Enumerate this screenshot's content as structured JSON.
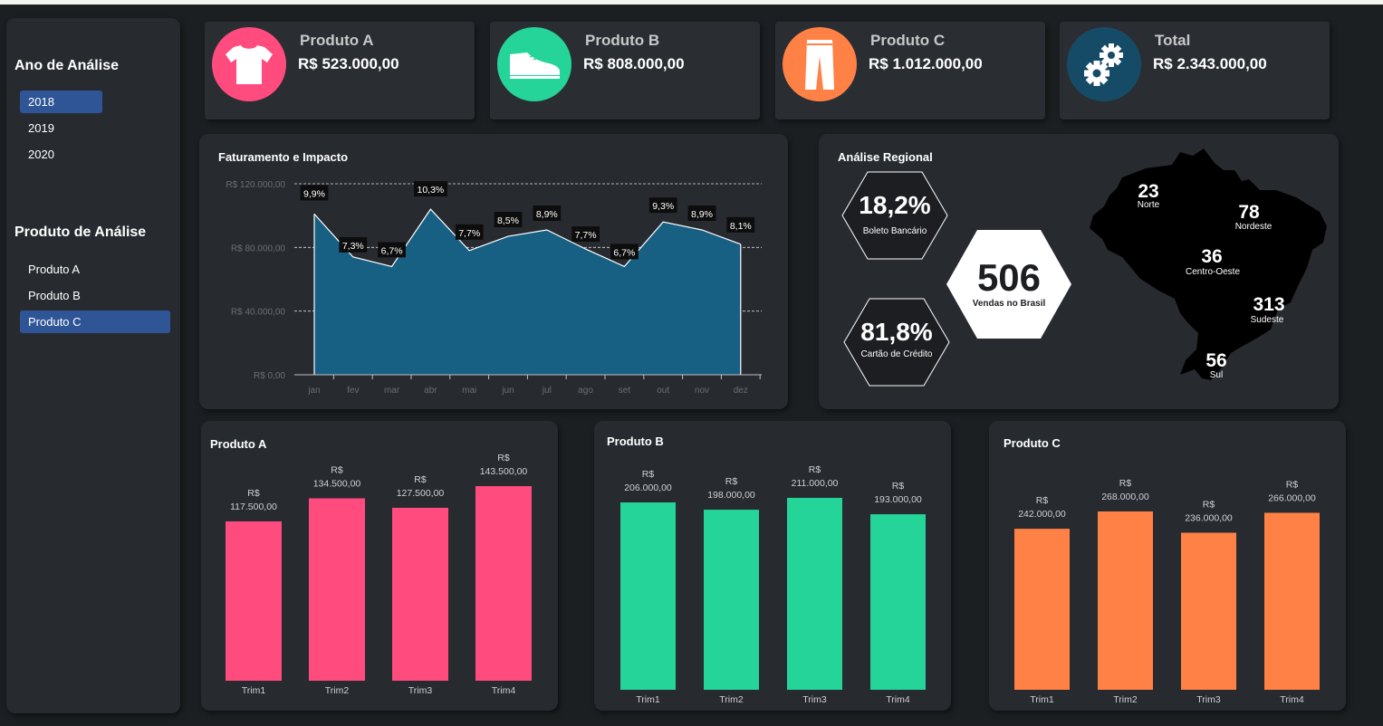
{
  "sidebar": {
    "year_title": "Ano de Análise",
    "years": [
      {
        "label": "2018",
        "active": true
      },
      {
        "label": "2019",
        "active": false
      },
      {
        "label": "2020",
        "active": false
      }
    ],
    "product_title": "Produto de Análise",
    "products": [
      {
        "label": "Produto A",
        "active": false
      },
      {
        "label": "Produto B",
        "active": false
      },
      {
        "label": "Produto C",
        "active": true
      }
    ]
  },
  "kpis": [
    {
      "name": "Produto A",
      "value": "R$ 523.000,00",
      "color": "#ff4b7d",
      "icon": "tshirt-icon"
    },
    {
      "name": "Produto B",
      "value": "R$ 808.000,00",
      "color": "#25d498",
      "icon": "shoe-icon"
    },
    {
      "name": "Produto C",
      "value": "R$ 1.012.000,00",
      "color": "#ff8145",
      "icon": "pants-icon"
    },
    {
      "name": "Total",
      "value": "R$ 2.343.000,00",
      "color": "#164b68",
      "icon": "gears-icon"
    }
  ],
  "chart_data": [
    {
      "type": "area",
      "title": "Faturamento e Impacto",
      "categories": [
        "jan",
        "fev",
        "mar",
        "abr",
        "mai",
        "jun",
        "jul",
        "ago",
        "set",
        "out",
        "nov",
        "dez"
      ],
      "values": [
        101000,
        74000,
        68000,
        104000,
        78000,
        87000,
        91000,
        79000,
        68000,
        96000,
        91000,
        82000
      ],
      "data_labels": [
        "9,9%",
        "7,3%",
        "6,7%",
        "10,3%",
        "7,7%",
        "8,5%",
        "8,9%",
        "7,7%",
        "6,7%",
        "9,3%",
        "8,9%",
        "8,1%"
      ],
      "yticks": [
        "R$ 0,00",
        "R$ 40.000,00",
        "R$ 80.000,00",
        "R$ 120.000,00"
      ],
      "ylim": [
        0,
        120000
      ],
      "color": "#185f84"
    },
    {
      "type": "bar",
      "title": "Produto A",
      "categories": [
        "Trim1",
        "Trim2",
        "Trim3",
        "Trim4"
      ],
      "values": [
        117500,
        134500,
        127500,
        143500
      ],
      "labels": [
        "117.500,00",
        "134.500,00",
        "127.500,00",
        "143.500,00"
      ],
      "currency": "R$",
      "color": "#ff4b7d"
    },
    {
      "type": "bar",
      "title": "Produto B",
      "categories": [
        "Trim1",
        "Trim2",
        "Trim3",
        "Trim4"
      ],
      "values": [
        206000,
        198000,
        211000,
        193000
      ],
      "labels": [
        "206.000,00",
        "198.000,00",
        "211.000,00",
        "193.000,00"
      ],
      "currency": "R$",
      "color": "#25d498"
    },
    {
      "type": "bar",
      "title": "Produto C",
      "categories": [
        "Trim1",
        "Trim2",
        "Trim3",
        "Trim4"
      ],
      "values": [
        242000,
        268000,
        236000,
        266000
      ],
      "labels": [
        "242.000,00",
        "268.000,00",
        "236.000,00",
        "266.000,00"
      ],
      "currency": "R$",
      "color": "#ff8145"
    }
  ],
  "regional": {
    "title": "Análise Regional",
    "boleto_pct": "18,2%",
    "boleto_label": "Boleto Bancário",
    "cartao_pct": "81,8%",
    "cartao_label": "Cartão de Crédito",
    "total_sales": "506",
    "total_label": "Vendas no Brasil",
    "regions": [
      {
        "name": "Norte",
        "value": "23"
      },
      {
        "name": "Nordeste",
        "value": "78"
      },
      {
        "name": "Centro-Oeste",
        "value": "36"
      },
      {
        "name": "Sudeste",
        "value": "313"
      },
      {
        "name": "Sul",
        "value": "56"
      }
    ]
  }
}
